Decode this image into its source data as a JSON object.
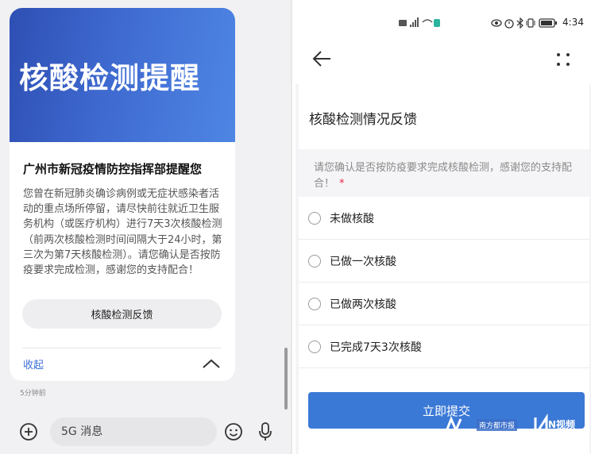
{
  "left": {
    "banner_title": "核酸检测提醒",
    "card_heading": "广州市新冠疫情防控指挥部提醒您",
    "card_body": "您曾在新冠肺炎确诊病例或无症状感染者活动的重点场所停留，请尽快前往就近卫生服务机构（或医疗机构）进行7天3次核酸检测（前两次核酸检测时间间隔大于24小时，第三次为第7天核酸检测）。请您确认是否按防疫要求完成检测，感谢您的支持配合！",
    "feedback_button": "核酸检测反馈",
    "collapse_label": "收起",
    "time_ago": "5分钟前",
    "compose": {
      "placeholder": "5G 消息"
    }
  },
  "right": {
    "status_bar": {
      "clock": "4:34"
    },
    "form_title": "核酸检测情况反馈",
    "question": "请您确认是否按防疫要求完成核酸检测，感谢您的支持配合！",
    "required_mark": "*",
    "options": [
      {
        "label": "未做核酸"
      },
      {
        "label": "已做一次核酸"
      },
      {
        "label": "已做两次核酸"
      },
      {
        "label": "已完成7天3次核酸"
      }
    ],
    "submit_label": "立即提交"
  },
  "watermark": {
    "text1": "南方都市报",
    "text2": "N视频"
  },
  "colors": {
    "accent": "#3b79d6",
    "banner": "#3f6ad0",
    "link": "#3b6fd6",
    "required": "#ee2244"
  },
  "icons": [
    "add-icon",
    "emoji-icon",
    "microphone-icon",
    "back-arrow-icon",
    "more-icon",
    "chevron-up-icon",
    "signal-icon",
    "wifi-icon",
    "battery-icon",
    "bluetooth-icon",
    "eye-icon",
    "alarm-icon",
    "vibrate-icon"
  ]
}
